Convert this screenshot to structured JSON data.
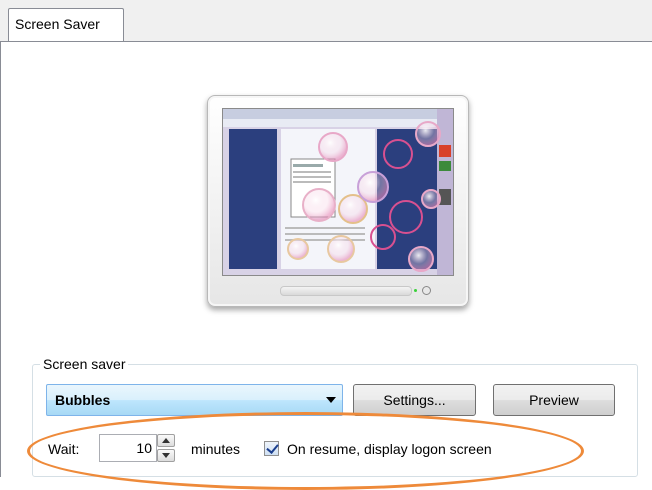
{
  "tabs": [
    {
      "label": "Screen Saver",
      "active": true
    }
  ],
  "preview": {
    "screensaver": "Bubbles"
  },
  "group": {
    "legend": "Screen saver"
  },
  "screensaver_select": {
    "selected": "Bubbles"
  },
  "buttons": {
    "settings": "Settings...",
    "preview": "Preview"
  },
  "wait": {
    "label": "Wait:",
    "value": "10",
    "unit": "minutes"
  },
  "logon_checkbox": {
    "label": "On resume, display logon screen",
    "checked": true
  },
  "colors": {
    "annotation": "#ee8a3a",
    "selection": "#bee6fd",
    "desktop": "#2b3f7e"
  }
}
